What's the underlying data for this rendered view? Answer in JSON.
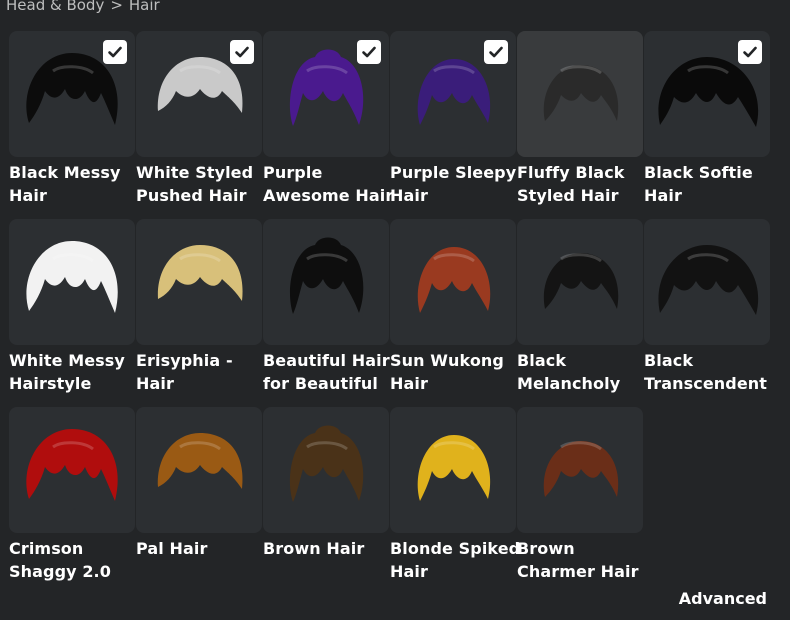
{
  "breadcrumb": {
    "parent": "Head & Body",
    "separator": ">",
    "current": "Hair"
  },
  "items": [
    {
      "name": "Black Messy\nHair",
      "equipped": true,
      "color": "#0c0c0c"
    },
    {
      "name": "White Styled\nPushed Hair",
      "equipped": true,
      "color": "#c9c9c9"
    },
    {
      "name": "Purple\nAwesome Hair",
      "equipped": true,
      "color": "#4a1a8e"
    },
    {
      "name": "Purple Sleepy\nHair",
      "equipped": true,
      "color": "#3a1d7a"
    },
    {
      "name": "Fluffy Black\nStyled Hair",
      "equipped": false,
      "color": "#2a2a2a"
    },
    {
      "name": "Black Softie\nHair",
      "equipped": true,
      "color": "#0a0a0a"
    },
    {
      "name": "White Messy\nHairstyle",
      "equipped": false,
      "color": "#f2f2f2"
    },
    {
      "name": "Erisyphia -\nHair",
      "equipped": false,
      "color": "#d8c07a"
    },
    {
      "name": "Beautiful Hair\nfor Beautiful",
      "equipped": false,
      "color": "#0e0e0e"
    },
    {
      "name": "Sun Wukong\nHair",
      "equipped": false,
      "color": "#9a3a20"
    },
    {
      "name": "Black\nMelancholy",
      "equipped": false,
      "color": "#141414"
    },
    {
      "name": "Black\nTranscendent",
      "equipped": false,
      "color": "#121212"
    },
    {
      "name": "Crimson\nShaggy 2.0",
      "equipped": false,
      "color": "#b00d0d"
    },
    {
      "name": "Pal Hair",
      "equipped": false,
      "color": "#9a5a14"
    },
    {
      "name": "Brown Hair",
      "equipped": false,
      "color": "#4a3218"
    },
    {
      "name": "Blonde Spiked\nHair",
      "equipped": false,
      "color": "#e0b21c"
    },
    {
      "name": "Brown\nCharmer Hair",
      "equipped": false,
      "color": "#6a2e18"
    }
  ],
  "advanced_label": "Advanced"
}
